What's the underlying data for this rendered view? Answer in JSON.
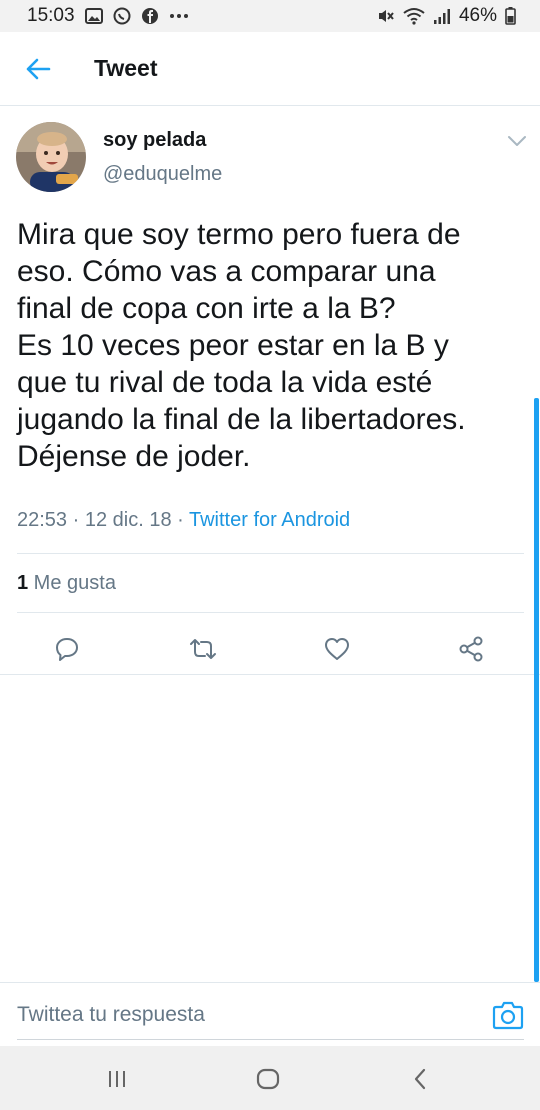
{
  "status_bar": {
    "time": "15:03",
    "battery": "46%"
  },
  "header": {
    "title": "Tweet"
  },
  "tweet": {
    "author_name": "soy pelada",
    "author_handle": "@eduquelme",
    "text": "Mira que soy termo pero fuera de\neso. Cómo vas a comparar una\nfinal de copa con irte a la B?\nEs 10 veces peor estar en la B y\nque tu rival de toda la vida esté\njugando la final de la libertadores.\nDéjense de joder.",
    "time": "22:53",
    "date": "12 dic. 18",
    "separator": " · ",
    "source": "Twitter for Android",
    "like_count": "1",
    "like_label": " Me gusta"
  },
  "reply": {
    "placeholder": "Twittea tu respuesta"
  },
  "colors": {
    "accent": "#1da1f2",
    "secondary_text": "#657786",
    "primary_text": "#14171a",
    "divider": "#e1e8ed"
  },
  "icons": {
    "back": "arrow-left-icon",
    "caret": "chevron-down-icon",
    "reply": "comment-icon",
    "retweet": "retweet-icon",
    "like": "heart-icon",
    "share": "share-icon",
    "camera": "camera-icon"
  }
}
